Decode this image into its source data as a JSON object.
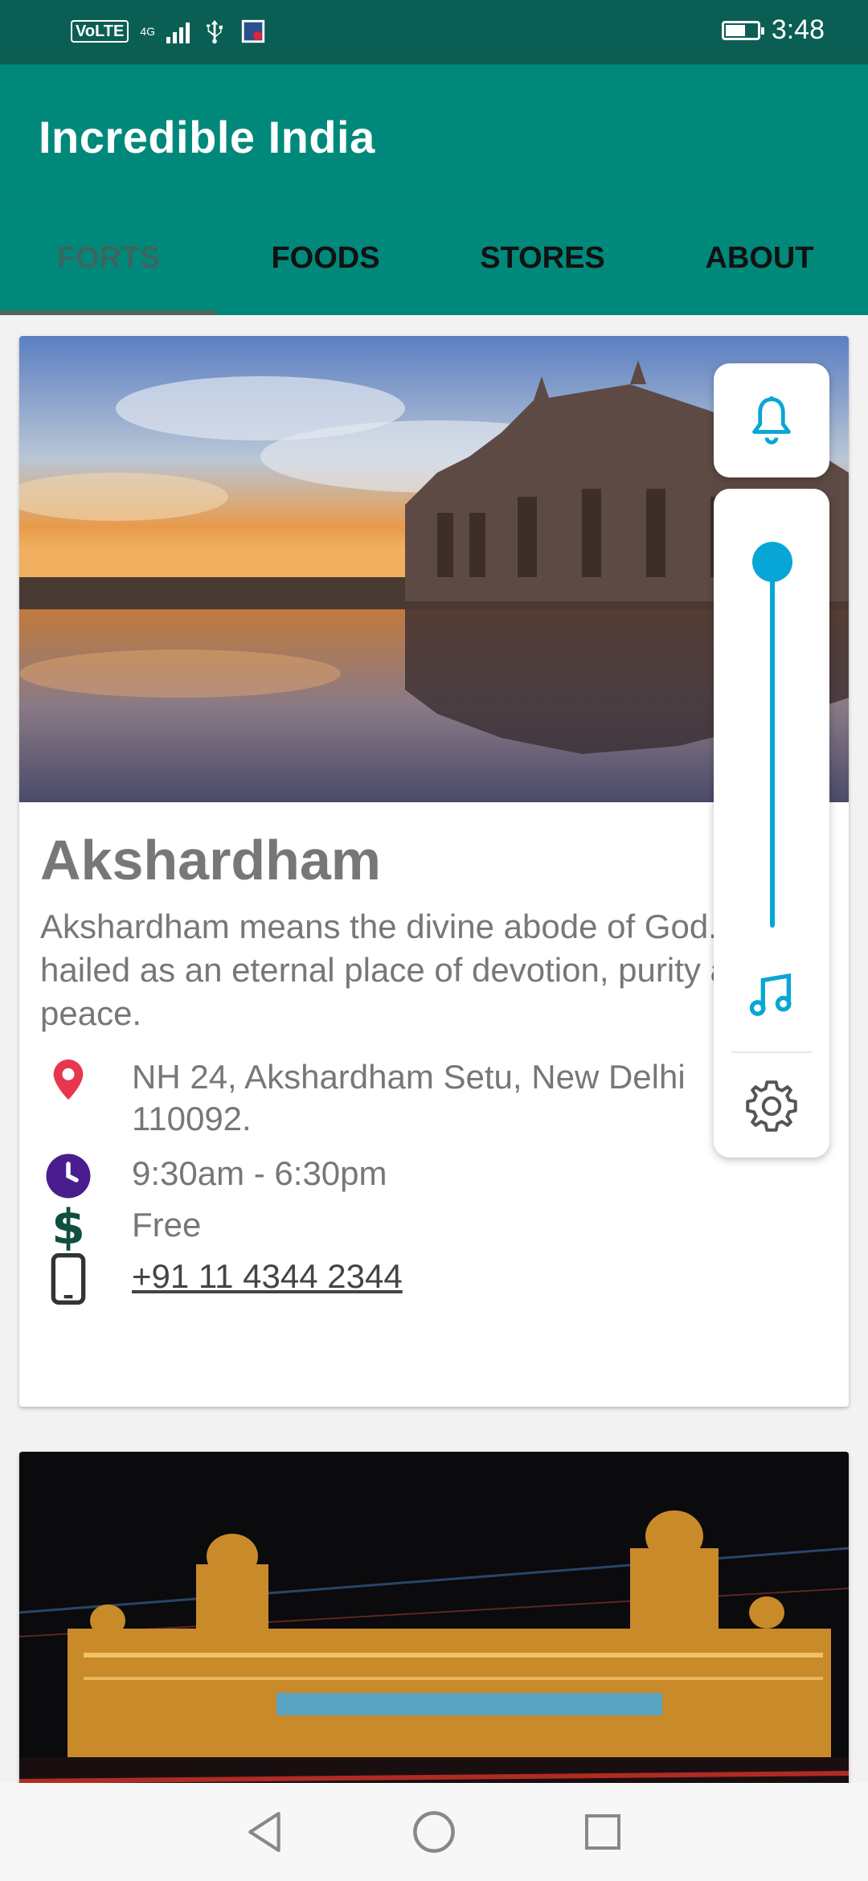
{
  "status_bar": {
    "network_label": "VoLTE",
    "network_type": "4G",
    "time": "3:48"
  },
  "app": {
    "title": "Incredible India",
    "accent_color": "#00897b",
    "status_color": "#0b5e53"
  },
  "tabs": [
    {
      "label": "FORTS",
      "active": true
    },
    {
      "label": "FOODS",
      "active": false
    },
    {
      "label": "STORES",
      "active": false
    },
    {
      "label": "ABOUT",
      "active": false
    }
  ],
  "cards": [
    {
      "name": "Akshardham",
      "description": "Akshardham means the divine abode of God. It is hailed as an eternal place of devotion, purity and peace.",
      "address": "NH 24, Akshardham Setu, New Delhi 110092.",
      "hours": "9:30am - 6:30pm",
      "price": "Free",
      "phone": "+91 11 4344 2344",
      "icons": {
        "address": "location-pin-icon",
        "hours": "clock-icon",
        "price": "dollar-icon",
        "phone": "phone-icon"
      },
      "icon_colors": {
        "address": "#e8364e",
        "hours": "#4a1d8f",
        "price": "#0f4f3f",
        "phone": "#333333"
      }
    },
    {
      "name": "",
      "image": "illuminated-palace-night-photo"
    }
  ],
  "volume_panel": {
    "level": 1.0,
    "accent": "#08a6d6",
    "icons": [
      "bell-icon",
      "music-note-icon",
      "gear-icon"
    ]
  },
  "nav_bar": {
    "buttons": [
      "back-icon",
      "home-icon",
      "recents-icon"
    ]
  }
}
